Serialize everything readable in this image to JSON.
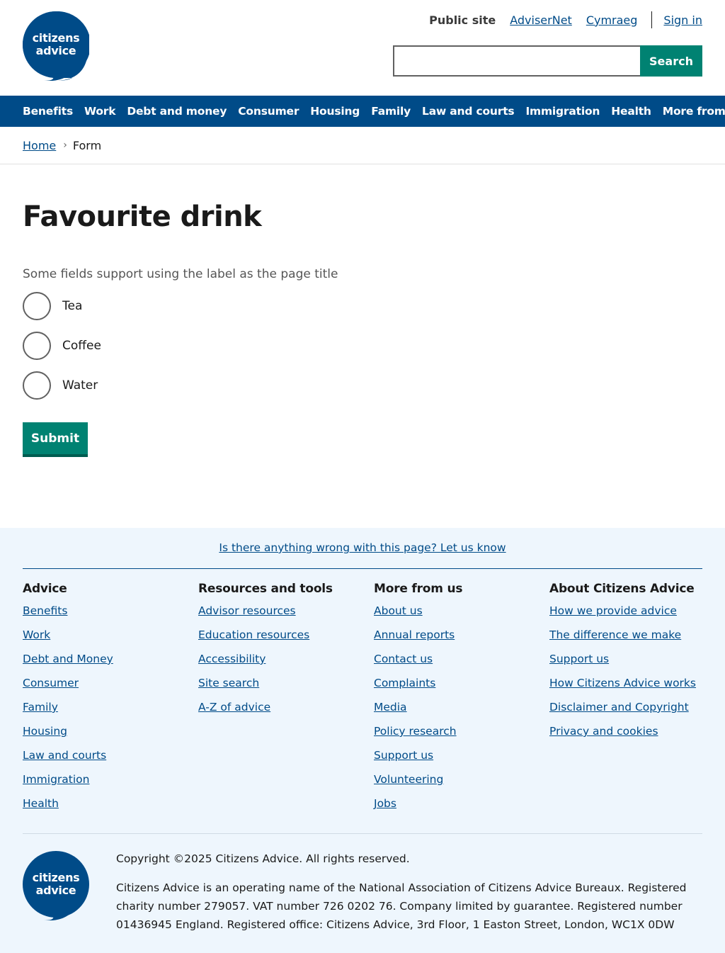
{
  "brand": {
    "logo_text": "citizens advice",
    "color": "#004b88",
    "accent": "#008272"
  },
  "top_links": {
    "public_site": "Public site",
    "advisernet": "AdviserNet",
    "cymraeg": "Cymraeg",
    "sign_in": "Sign in"
  },
  "search": {
    "button_label": "Search",
    "value": ""
  },
  "nav": [
    "Benefits",
    "Work",
    "Debt and money",
    "Consumer",
    "Housing",
    "Family",
    "Law and courts",
    "Immigration",
    "Health",
    "More from us"
  ],
  "breadcrumb": {
    "home": "Home",
    "current": "Form"
  },
  "form": {
    "title": "Favourite drink",
    "hint": "Some fields support using the label as the page title",
    "options": [
      "Tea",
      "Coffee",
      "Water"
    ],
    "submit_label": "Submit"
  },
  "footer": {
    "feedback_link": "Is there anything wrong with this page? Let us know",
    "columns": [
      {
        "heading": "Advice",
        "links": [
          "Benefits",
          "Work",
          "Debt and Money",
          "Consumer",
          "Family",
          "Housing",
          "Law and courts",
          "Immigration",
          "Health"
        ]
      },
      {
        "heading": "Resources and tools",
        "links": [
          "Advisor resources",
          "Education resources",
          "Accessibility",
          "Site search",
          "A-Z of advice"
        ]
      },
      {
        "heading": "More from us",
        "links": [
          "About us",
          "Annual reports",
          "Contact us",
          "Complaints",
          "Media",
          "Policy research",
          "Support us",
          "Volunteering",
          "Jobs"
        ]
      },
      {
        "heading": "About Citizens Advice",
        "links": [
          "How we provide advice",
          "The difference we make",
          "Support us",
          "How Citizens Advice works",
          "Disclaimer and Copyright",
          "Privacy and cookies"
        ]
      }
    ],
    "copyright": "Copyright ©2025 Citizens Advice. All rights reserved.",
    "legal": "Citizens Advice is an operating name of the National Association of Citizens Advice Bureaux. Registered charity number 279057. VAT number 726 0202 76. Company limited by guarantee. Registered number 01436945 England. Registered office: Citizens Advice, 3rd Floor, 1 Easton Street, London, WC1X 0DW"
  }
}
